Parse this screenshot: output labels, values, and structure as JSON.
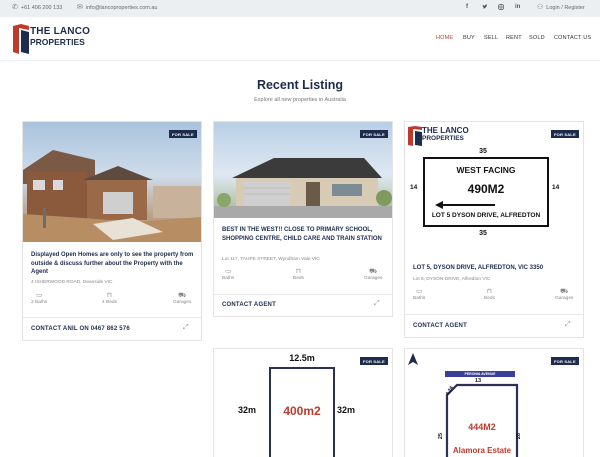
{
  "topbar": {
    "phone": "+61 406 200 133",
    "email": "info@lancoproperties.com.au",
    "social": [
      "f",
      "t",
      "ig",
      "in"
    ],
    "login": "Login / Register"
  },
  "brand": {
    "line1": "THE LANCO",
    "line2": "PROPERTIES",
    "color": "#1d2c4d",
    "accent": "#c0392b"
  },
  "nav": [
    "HOME",
    "BUY",
    "SELL",
    "RENT",
    "SOLD",
    "CONTACT US"
  ],
  "section": {
    "title": "Recent Listing",
    "subtitle": "Explore all new properties in Australia"
  },
  "listings": [
    {
      "badge": "FOR SALE",
      "title": "Displayed Open Homes are only to see the property from outside & discuss further about the Property with the Agent",
      "address": "4 ISHERWOOD ROAD, Deanside VIC",
      "baths": "2 Baths",
      "beds": "4 Beds",
      "garages": "Garages",
      "contact": "CONTACT ANIL ON 0467 862 576"
    },
    {
      "badge": "FOR SALE",
      "title": "BEST IN THE WEST!! CLOSE TO PRIMARY SCHOOL, SHOPPING CENTRE, CHILD CARE AND TRAIN STATION",
      "address": "Lot 117, TAUPE STREET, Wyndham Vale VIC",
      "baths": "Baths",
      "beds": "Beds",
      "garages": "Garages",
      "contact": "CONTACT AGENT"
    },
    {
      "badge": "FOR SALE",
      "title": "LOT 5, DYSON DRIVE, ALFREDTON, VIC 3350",
      "address": "Lot 5, DYSON DRIVE, Alfredton VIC",
      "baths": "Baths",
      "beds": "Beds",
      "garages": "Garages",
      "contact": "CONTACT AGENT",
      "plan": {
        "logo1": "THE LANCO",
        "logo2": "PROPERTIES",
        "facing": "WEST FACING",
        "area": "490M2",
        "lot": "LOT 5 DYSON DRIVE,  ALFREDTON",
        "top": "35",
        "bottom": "35",
        "left": "14",
        "right": "14"
      }
    },
    {
      "badge": "FOR SALE",
      "plan": {
        "top": "12.5m",
        "left": "32m",
        "right": "32m",
        "area": "400m2"
      }
    },
    {
      "badge": "FOR SALE",
      "plan": {
        "road": "PERONIA AVENUE",
        "top": "13",
        "diag": "4.24",
        "left": "25",
        "right": "28",
        "area": "444M2",
        "estate": "Alamora Estate"
      }
    }
  ]
}
